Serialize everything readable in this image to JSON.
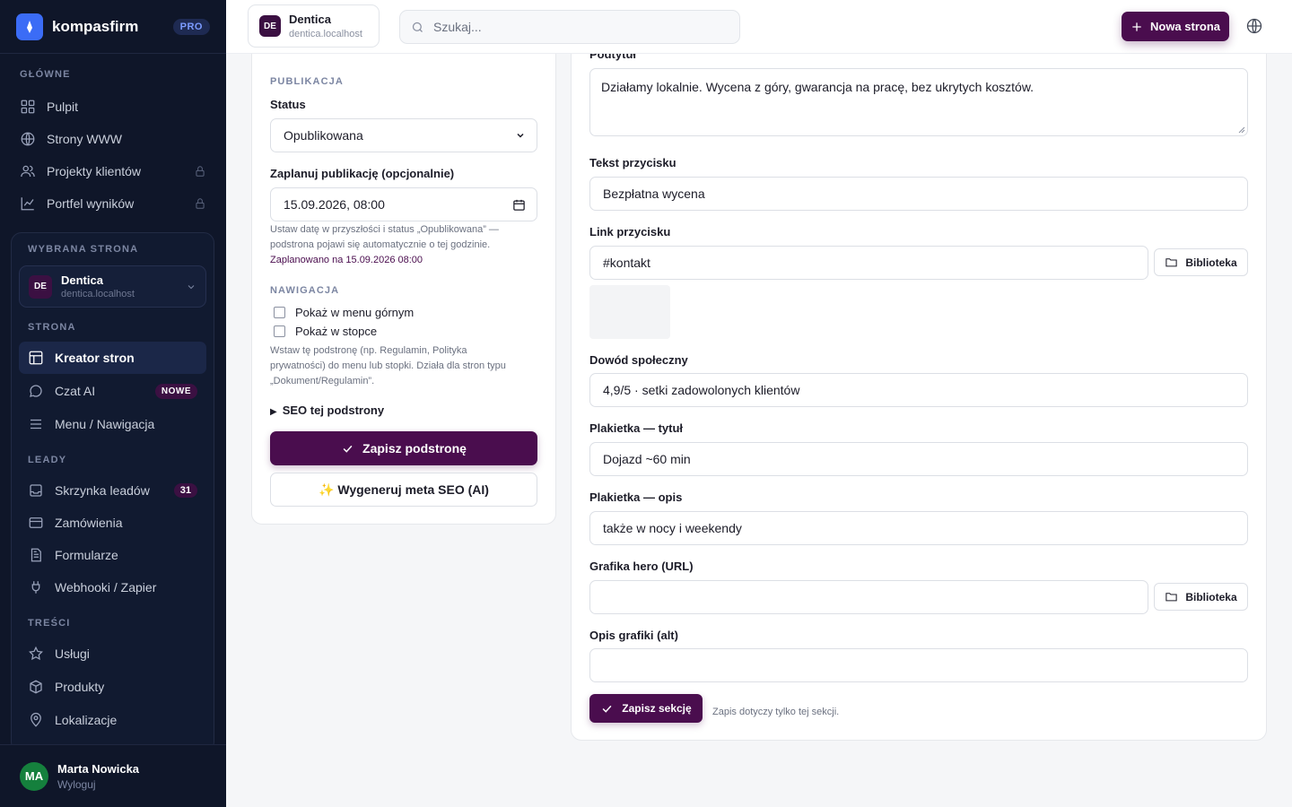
{
  "brand": {
    "name": "kompasfirm",
    "badge": "PRO"
  },
  "sidebar": {
    "main_label": "GŁÓWNE",
    "main_items": [
      {
        "label": "Pulpit",
        "icon": "grid-icon",
        "locked": false
      },
      {
        "label": "Strony WWW",
        "icon": "globe-icon",
        "locked": false
      },
      {
        "label": "Projekty klientów",
        "icon": "users-icon",
        "locked": true
      },
      {
        "label": "Portfel wyników",
        "icon": "chart-icon",
        "locked": true
      }
    ],
    "selected_site_label": "WYBRANA STRONA",
    "selected_site": {
      "initials": "DE",
      "name": "Dentica",
      "domain": "dentica.localhost"
    },
    "page_label": "STRONA",
    "page_items": [
      {
        "label": "Kreator stron",
        "active": true
      },
      {
        "label": "Czat AI",
        "badge": "NOWE"
      },
      {
        "label": "Menu / Nawigacja"
      }
    ],
    "leads_label": "LEADY",
    "leads_items": [
      {
        "label": "Skrzynka leadów",
        "count": "31"
      },
      {
        "label": "Zamówienia"
      },
      {
        "label": "Formularze"
      },
      {
        "label": "Webhooki / Zapier"
      }
    ],
    "content_label": "TREŚCI",
    "content_items": [
      {
        "label": "Usługi"
      },
      {
        "label": "Produkty"
      },
      {
        "label": "Lokalizacje"
      }
    ],
    "user": {
      "initials": "MA",
      "name": "Marta Nowicka",
      "logout": "Wyloguj"
    }
  },
  "topbar": {
    "site": {
      "initials": "DE",
      "name": "Dentica",
      "domain": "dentica.localhost"
    },
    "search_placeholder": "Szukaj...",
    "new_page_label": "Nowa strona"
  },
  "publication": {
    "section_label": "PUBLIKACJA",
    "status_label": "Status",
    "status_value": "Opublikowana",
    "schedule_label": "Zaplanuj publikację (opcjonalnie)",
    "schedule_value": "15.09.2026, 08:00",
    "help_line1": "Ustaw datę w przyszłości i status „Opublikowana” —",
    "help_line2": "podstrona pojawi się automatycznie o tej godzinie.",
    "scheduled_note": "Zaplanowano na 15.09.2026 08:00"
  },
  "navigation": {
    "section_label": "NAWIGACJA",
    "show_top": "Pokaż w menu górnym",
    "show_footer": "Pokaż w stopce",
    "help_line1": "Wstaw tę podstronę (np. Regulamin, Polityka",
    "help_line2": "prywatności) do menu lub stopki. Działa dla stron typu",
    "help_line3": "„Dokument/Regulamin”."
  },
  "seo_toggle": "SEO tej podstrony",
  "save_page_label": "Zapisz podstronę",
  "generate_seo_label": "✨ Wygeneruj meta SEO (AI)",
  "section_form": {
    "subtitle_label": "Podtytuł",
    "subtitle_value": "Działamy lokalnie. Wycena z góry, gwarancja na pracę, bez ukrytych kosztów.",
    "button_text_label": "Tekst przycisku",
    "button_text_value": "Bezpłatna wycena",
    "button_link_label": "Link przycisku",
    "button_link_value": "#kontakt",
    "library_label": "Biblioteka",
    "social_proof_label": "Dowód społeczny",
    "social_proof_value": "4,9/5 · setki zadowolonych klientów",
    "badge_title_label": "Plakietka — tytuł",
    "badge_title_value": "Dojazd ~60 min",
    "badge_desc_label": "Plakietka — opis",
    "badge_desc_value": "także w nocy i weekendy",
    "hero_label": "Grafika hero (URL)",
    "hero_value": "",
    "alt_label": "Opis grafiki (alt)",
    "alt_value": "",
    "save_section_label": "Zapisz sekcję",
    "save_note": "Zapis dotyczy tylko tej sekcji."
  }
}
